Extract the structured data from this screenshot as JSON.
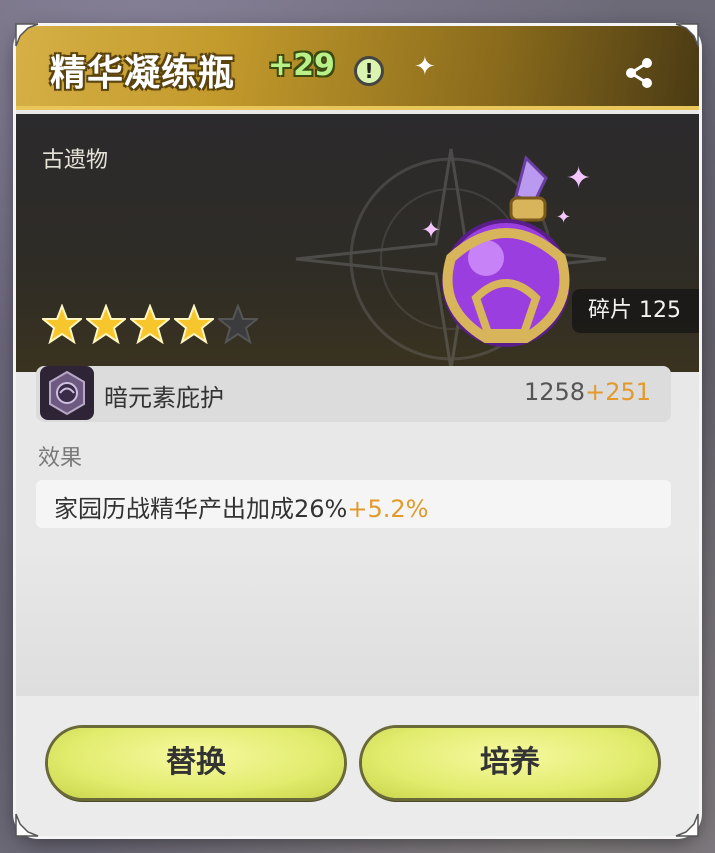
{
  "item": {
    "name": "精华凝练瓶",
    "level": "+29",
    "category": "古遗物",
    "stars_total": 5,
    "stars_filled": 4,
    "fragments": "碎片 125"
  },
  "stat": {
    "name": "暗元素庇护",
    "base": "1258",
    "bonus": "+251"
  },
  "effect": {
    "label": "效果",
    "text": "家园历战精华产出加成26%",
    "bonus": "+5.2%"
  },
  "buttons": {
    "replace": "替换",
    "upgrade": "培养"
  },
  "icons": {
    "info": "!",
    "sparkle": "✦"
  },
  "colors": {
    "title_gold": "#c39a2c",
    "bonus_orange": "#e29a2c",
    "level_green": "#b9f08a",
    "button_yellow": "#e2ec6e"
  }
}
